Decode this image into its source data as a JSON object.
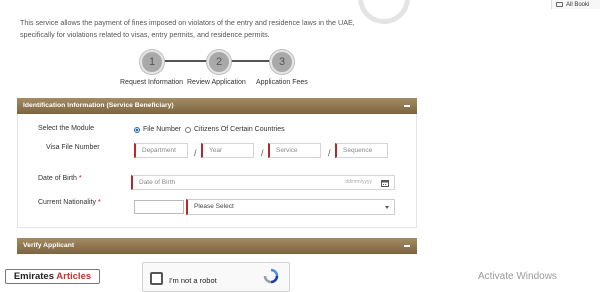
{
  "browser": {
    "bookmarks_label": "All Booki"
  },
  "intro_text": "This service allows the payment of fines imposed on violators of the entry and residence laws in the UAE, specifically for violations related to visas, entry permits, and residence permits.",
  "steps": [
    {
      "number": "1",
      "label": "Request Information"
    },
    {
      "number": "2",
      "label": "Review Application"
    },
    {
      "number": "3",
      "label": "Application Fees"
    }
  ],
  "identification_panel": {
    "title": "Identification Information (Service Beneficiary)",
    "select_module_label": "Select the Module",
    "module_options": [
      {
        "label": "File Number",
        "selected": true
      },
      {
        "label": "Citizens Of Certain Countries",
        "selected": false
      }
    ],
    "visa_file_label": "Visa File Number",
    "visa_file_placeholders": {
      "department": "Department",
      "year": "Year",
      "service": "Service",
      "sequence": "Sequence"
    },
    "separator": "/",
    "dob_label": "Date of Birth",
    "dob_placeholder": "Date of Birth",
    "dob_format": "dd/mm/yyyy",
    "nationality_label": "Current Nationality",
    "nationality_code_value": "",
    "nationality_select": "Please Select",
    "required_mark": "*"
  },
  "verify_panel": {
    "title": "Verify Applicant"
  },
  "captcha": {
    "text": "I'm not a robot"
  },
  "watermark": {
    "part1": "Emirates",
    "part2": "Articles"
  },
  "os_overlay": {
    "text": "Activate Windows"
  },
  "colors": {
    "panel_bar": "#8c7450",
    "required_border": "#b22a2a",
    "radio_accent": "#2a6ebb"
  }
}
